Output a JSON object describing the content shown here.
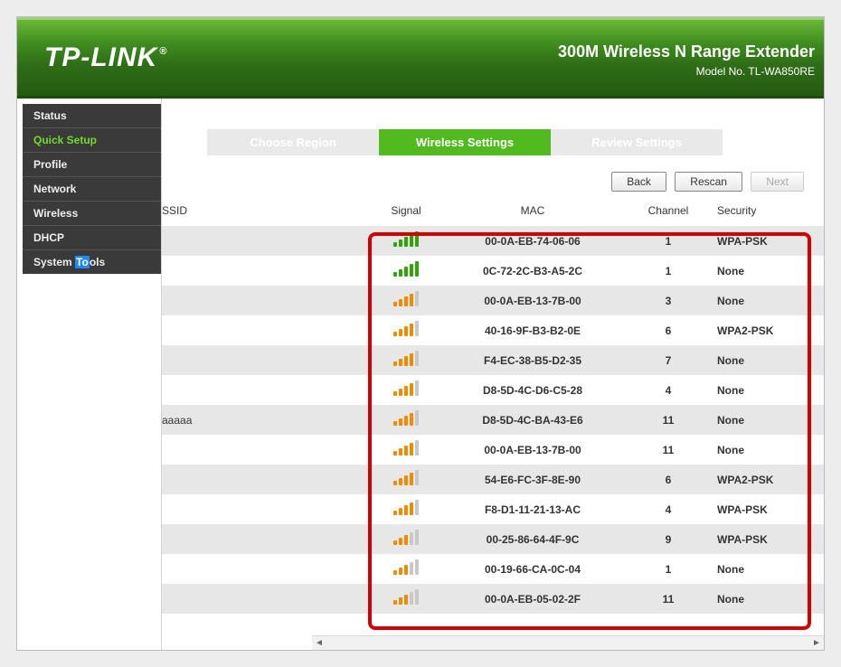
{
  "header": {
    "logo": "TP-LINK",
    "product": "300M Wireless N Range Extender",
    "model": "Model No. TL-WA850RE"
  },
  "sidebar": {
    "items": [
      {
        "label": "Status",
        "name": "nav-status"
      },
      {
        "label": "Quick Setup",
        "name": "nav-quick-setup",
        "active": true
      },
      {
        "label": "Profile",
        "name": "nav-profile"
      },
      {
        "label": "Network",
        "name": "nav-network"
      },
      {
        "label": "Wireless",
        "name": "nav-wireless"
      },
      {
        "label": "DHCP",
        "name": "nav-dhcp"
      },
      {
        "label": "System Tools",
        "name": "nav-system-tools",
        "highlight_substring": "To"
      }
    ]
  },
  "stepper": {
    "steps": [
      {
        "label": "Choose Region",
        "state": "inactive"
      },
      {
        "label": "Wireless Settings",
        "state": "active"
      },
      {
        "label": "Review Settings",
        "state": "inactive"
      }
    ]
  },
  "buttons": {
    "back": "Back",
    "rescan": "Rescan",
    "next": "Next"
  },
  "columns": {
    "ssid": "SSID",
    "signal": "Signal",
    "mac": "MAC",
    "channel": "Channel",
    "security": "Security"
  },
  "aplist": [
    {
      "ssid": "",
      "signal": {
        "level": 5,
        "color": "green"
      },
      "mac": "00-0A-EB-74-06-06",
      "channel": "1",
      "security": "WPA-PSK"
    },
    {
      "ssid": "",
      "signal": {
        "level": 5,
        "color": "green"
      },
      "mac": "0C-72-2C-B3-A5-2C",
      "channel": "1",
      "security": "None"
    },
    {
      "ssid": "",
      "signal": {
        "level": 4,
        "color": "orange"
      },
      "mac": "00-0A-EB-13-7B-00",
      "channel": "3",
      "security": "None"
    },
    {
      "ssid": "",
      "signal": {
        "level": 4,
        "color": "orange"
      },
      "mac": "40-16-9F-B3-B2-0E",
      "channel": "6",
      "security": "WPA2-PSK"
    },
    {
      "ssid": "",
      "signal": {
        "level": 4,
        "color": "orange"
      },
      "mac": "F4-EC-38-B5-D2-35",
      "channel": "7",
      "security": "None"
    },
    {
      "ssid": "",
      "signal": {
        "level": 4,
        "color": "orange"
      },
      "mac": "D8-5D-4C-D6-C5-28",
      "channel": "4",
      "security": "None"
    },
    {
      "ssid": "aaaaa",
      "signal": {
        "level": 4,
        "color": "orange"
      },
      "mac": "D8-5D-4C-BA-43-E6",
      "channel": "11",
      "security": "None"
    },
    {
      "ssid": "",
      "signal": {
        "level": 4,
        "color": "orange"
      },
      "mac": "00-0A-EB-13-7B-00",
      "channel": "11",
      "security": "None"
    },
    {
      "ssid": "",
      "signal": {
        "level": 4,
        "color": "orange"
      },
      "mac": "54-E6-FC-3F-8E-90",
      "channel": "6",
      "security": "WPA2-PSK"
    },
    {
      "ssid": "",
      "signal": {
        "level": 4,
        "color": "orange"
      },
      "mac": "F8-D1-11-21-13-AC",
      "channel": "4",
      "security": "WPA-PSK"
    },
    {
      "ssid": "",
      "signal": {
        "level": 3,
        "color": "orange"
      },
      "mac": "00-25-86-64-4F-9C",
      "channel": "9",
      "security": "WPA-PSK"
    },
    {
      "ssid": "",
      "signal": {
        "level": 3,
        "color": "orange"
      },
      "mac": "00-19-66-CA-0C-04",
      "channel": "1",
      "security": "None"
    },
    {
      "ssid": "",
      "signal": {
        "level": 3,
        "color": "orange"
      },
      "mac": "00-0A-EB-05-02-2F",
      "channel": "11",
      "security": "None"
    }
  ]
}
